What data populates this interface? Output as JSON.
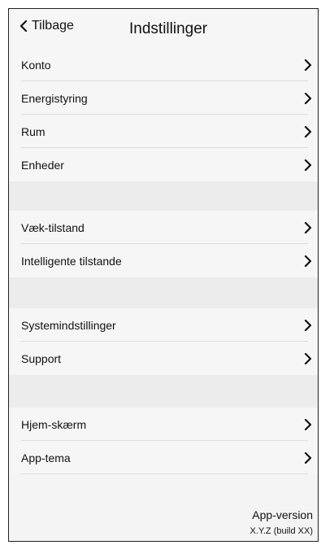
{
  "header": {
    "back_label": "Tilbage",
    "title": "Indstillinger"
  },
  "groups": [
    {
      "items": [
        "Konto",
        "Energistyring",
        "Rum",
        "Enheder"
      ]
    },
    {
      "items": [
        "Væk-tilstand",
        "Intelligente tilstande"
      ]
    },
    {
      "items": [
        "Systemindstillinger",
        "Support"
      ]
    },
    {
      "items": [
        "Hjem-skærm",
        "App-tema"
      ]
    }
  ],
  "footer": {
    "version_label": "App-version",
    "version_value": "X.Y.Z (build XX)"
  },
  "icons": {
    "back": "chevron-left-icon",
    "row": "chevron-right-icon"
  }
}
